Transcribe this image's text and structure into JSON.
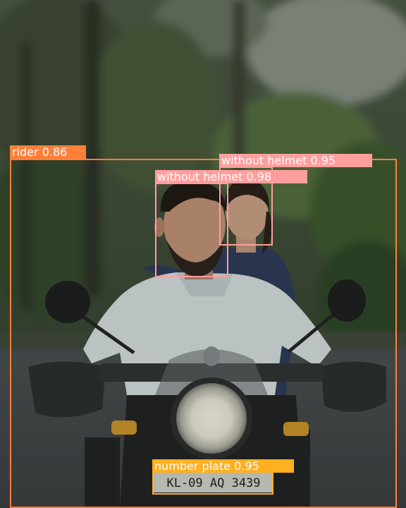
{
  "detections": [
    {
      "id": "rider",
      "label": "rider 0.86",
      "color": "#ff7f3a"
    },
    {
      "id": "helmet-1",
      "label": "without helmet 0.98",
      "color": "#ff9e9e"
    },
    {
      "id": "helmet-2",
      "label": "without helmet 0.95",
      "color": "#ff9e9e"
    },
    {
      "id": "plate",
      "label": "number plate 0.95",
      "color": "#ffb020"
    }
  ],
  "plate_text": "KL-09 AQ 3439"
}
